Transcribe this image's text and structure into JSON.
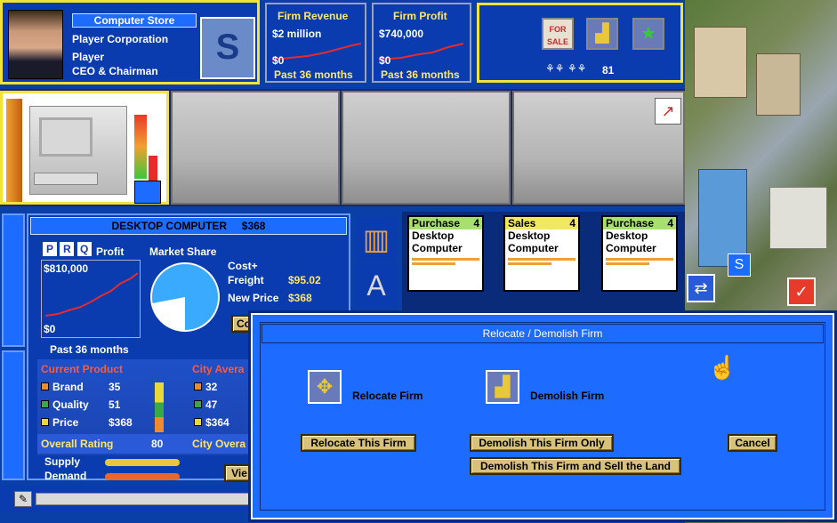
{
  "header": {
    "firm_type": "Computer Store",
    "company": "Player Corporation",
    "player_name": "Player",
    "player_title": "CEO & Chairman"
  },
  "revenue": {
    "title": "Firm Revenue",
    "value": "$2 million",
    "zero": "$0",
    "period": "Past 36 months"
  },
  "profit": {
    "title": "Firm Profit",
    "value": "$740,000",
    "zero": "$0",
    "period": "Past 36 months"
  },
  "tools": {
    "count": "81",
    "icons": [
      "for-sale-icon",
      "bulldozer-icon",
      "city-builder-icon"
    ]
  },
  "product": {
    "title": "DESKTOP COMPUTER",
    "price": "$368",
    "prq": [
      "P",
      "R",
      "Q"
    ],
    "profit_label": "Profit",
    "profit_value": "$810,000",
    "profit_zero": "$0",
    "period": "Past 36 months",
    "market_share_label": "Market Share",
    "market_share_fraction": 0.78,
    "cost_label_1": "Cost+",
    "cost_label_2": "Freight",
    "cost_value": "$95.02",
    "new_price_label": "New Price",
    "new_price_value": "$368",
    "co_btn": "Co"
  },
  "attributes": {
    "current_header": "Current Product",
    "city_header": "City Avera",
    "rows": [
      {
        "label": "Brand",
        "value": "35",
        "city": "32",
        "color": "#f08a30"
      },
      {
        "label": "Quality",
        "value": "51",
        "city": "47",
        "color": "#3aa84a"
      },
      {
        "label": "Price",
        "value": "$368",
        "city": "$364",
        "color": "#e8d83a"
      }
    ],
    "overall_label": "Overall Rating",
    "overall_value": "80",
    "city_overall": "City Overa",
    "supply_label": "Supply",
    "demand_label": "Demand",
    "view_btn": "Vie"
  },
  "units": [
    {
      "type": "Purchase",
      "num": "4",
      "line1": "Desktop",
      "line2": "Computer"
    },
    {
      "type": "Sales",
      "num": "4",
      "line1": "Desktop",
      "line2": "Computer"
    },
    {
      "type": "Purchase",
      "num": "4",
      "line1": "Desktop",
      "line2": "Computer"
    }
  ],
  "dialog": {
    "title": "Relocate / Demolish Firm",
    "relocate_label": "Relocate Firm",
    "demolish_label": "Demolish Firm",
    "relocate_btn": "Relocate This Firm",
    "demolish_only_btn": "Demolish This Firm Only",
    "demolish_sell_btn": "Demolish This Firm and Sell the Land",
    "cancel_btn": "Cancel"
  }
}
